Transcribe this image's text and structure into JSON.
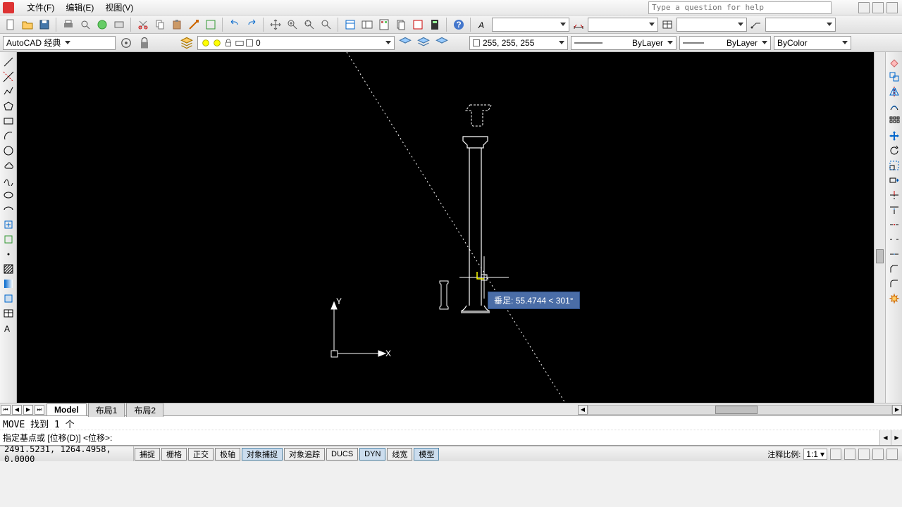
{
  "menubar": {
    "items": [
      "文件(F)",
      "编辑(E)",
      "视图(V)"
    ],
    "help_placeholder": "Type a question for help"
  },
  "toolbar2": {
    "workspace": "AutoCAD 经典",
    "layer_name": "0",
    "color_value": "255, 255, 255",
    "linetype": "ByLayer",
    "lineweight": "ByLayer",
    "plotstyle": "ByColor"
  },
  "canvas": {
    "tooltip_label": "垂足:",
    "tooltip_value": "55.4744 < 301°",
    "axis_x": "X",
    "axis_y": "Y"
  },
  "tabs": {
    "model": "Model",
    "layout1": "布局1",
    "layout2": "布局2"
  },
  "command": {
    "history": "MOVE 找到 1 个",
    "prompt": "指定基点或 [位移(D)] <位移>:"
  },
  "statusbar": {
    "coords": "2491.5231, 1264.4958, 0.0000",
    "toggles": [
      "捕捉",
      "栅格",
      "正交",
      "极轴",
      "对象捕捉",
      "对象追踪",
      "DUCS",
      "DYN",
      "线宽",
      "模型"
    ],
    "anno_label": "注释比例:",
    "anno_scale": "1:1"
  }
}
